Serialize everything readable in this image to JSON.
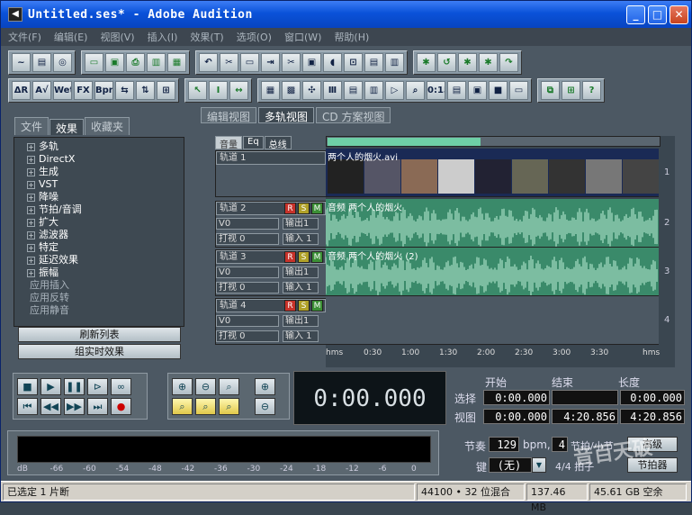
{
  "window": {
    "title": "Untitled.ses* - Adobe Audition",
    "icon": "audition-icon"
  },
  "menu": [
    "文件(F)",
    "编辑(E)",
    "视图(V)",
    "插入(I)",
    "效果(T)",
    "选项(O)",
    "窗口(W)",
    "帮助(H)"
  ],
  "toolbar1": [
    [
      "~",
      "▤",
      "◎"
    ],
    [
      "▭",
      "▣",
      "⎙",
      "▥",
      "▦"
    ],
    [
      "↶",
      "✂",
      "▭",
      "⇥",
      "✂",
      "▣",
      "◖",
      "⊡",
      "▤",
      "▥"
    ],
    [
      "✱",
      "↺",
      "✱",
      "✱",
      "↷"
    ]
  ],
  "toolbar2": [
    [
      "ΔR",
      "A√",
      "Wet",
      "FX",
      "Bpm",
      "⇆",
      "⇅",
      "⊞"
    ],
    [
      "↖",
      "I",
      "↔"
    ],
    [
      "▦",
      "▩",
      "✣",
      "Ⅲ",
      "▤",
      "▥",
      "▷",
      "⌕",
      "0:15",
      "▤",
      "▣",
      "■",
      "▭"
    ],
    [
      "⧉",
      "⊞",
      "?"
    ]
  ],
  "left_tabs": [
    "文件",
    "效果",
    "收藏夹"
  ],
  "effects_tree": [
    "多轨",
    "DirectX",
    "生成",
    "VST",
    "降噪",
    "节拍/音调",
    "扩大",
    "滤波器",
    "特定",
    "延迟效果",
    "振幅"
  ],
  "effects_tree_sub": [
    "应用插入",
    "应用反转",
    "应用静音"
  ],
  "left_buttons": {
    "refresh": "刷新列表",
    "realtime": "组实时效果"
  },
  "view_tabs": [
    "编辑视图",
    "多轨视图",
    "CD 方案视图"
  ],
  "track_header_tabs": [
    "音量",
    "Eq",
    "总线"
  ],
  "tracks": [
    {
      "name": "轨道 1",
      "num": "1",
      "clip": "两个人的烟火.avi",
      "type": "video"
    },
    {
      "name": "轨道 2",
      "num": "2",
      "clip": "音频 两个人的烟火",
      "type": "audio",
      "vol": "V0",
      "pan": "打视 0",
      "out": "输出1",
      "in": "输入 1"
    },
    {
      "name": "轨道 3",
      "num": "3",
      "clip": "音频 两个人的烟火 (2)",
      "type": "audio",
      "vol": "V0",
      "pan": "打视 0",
      "out": "输出1",
      "in": "输入 1"
    },
    {
      "name": "轨道 4",
      "num": "4",
      "clip": "",
      "type": "empty",
      "vol": "V0",
      "pan": "打视 0",
      "out": "输出1",
      "in": "输入 1"
    }
  ],
  "rsm": {
    "r": "R",
    "s": "S",
    "m": "M"
  },
  "ruler": [
    "hms",
    "0:30",
    "1:00",
    "1:30",
    "2:00",
    "2:30",
    "3:00",
    "3:30",
    "hms"
  ],
  "transport": {
    "time": "0:00.000"
  },
  "selection": {
    "col_start": "开始",
    "col_end": "结束",
    "col_length": "长度",
    "row_sel": "选择",
    "row_view": "视图",
    "sel_start": "0:00.000",
    "sel_end": "",
    "sel_len": "0:00.000",
    "view_start": "0:00.000",
    "view_end": "4:20.856",
    "view_len": "4:20.856"
  },
  "meter_scale": [
    "dB",
    "-66",
    "-60",
    "-54",
    "-48",
    "-42",
    "-36",
    "-30",
    "-24",
    "-18",
    "-12",
    "-6",
    "0"
  ],
  "tempo": {
    "label": "节奏",
    "bpm": "129",
    "bpm_unit": "bpm,",
    "beats": "4",
    "beats_unit": "节拍/小节",
    "advanced": "高级",
    "key_label": "键",
    "key": "(无)",
    "meter": "4/4 拍子",
    "meter_btn": "节拍器"
  },
  "status": {
    "sel": "已选定 1 片断",
    "rate": "44100 • 32 位混合",
    "mem": "137.46 MB",
    "disk": "45.61 GB 空余"
  },
  "watermark": "音百天破",
  "colors": {
    "accent": "#6ecfa6",
    "title": "#0a52d9"
  }
}
